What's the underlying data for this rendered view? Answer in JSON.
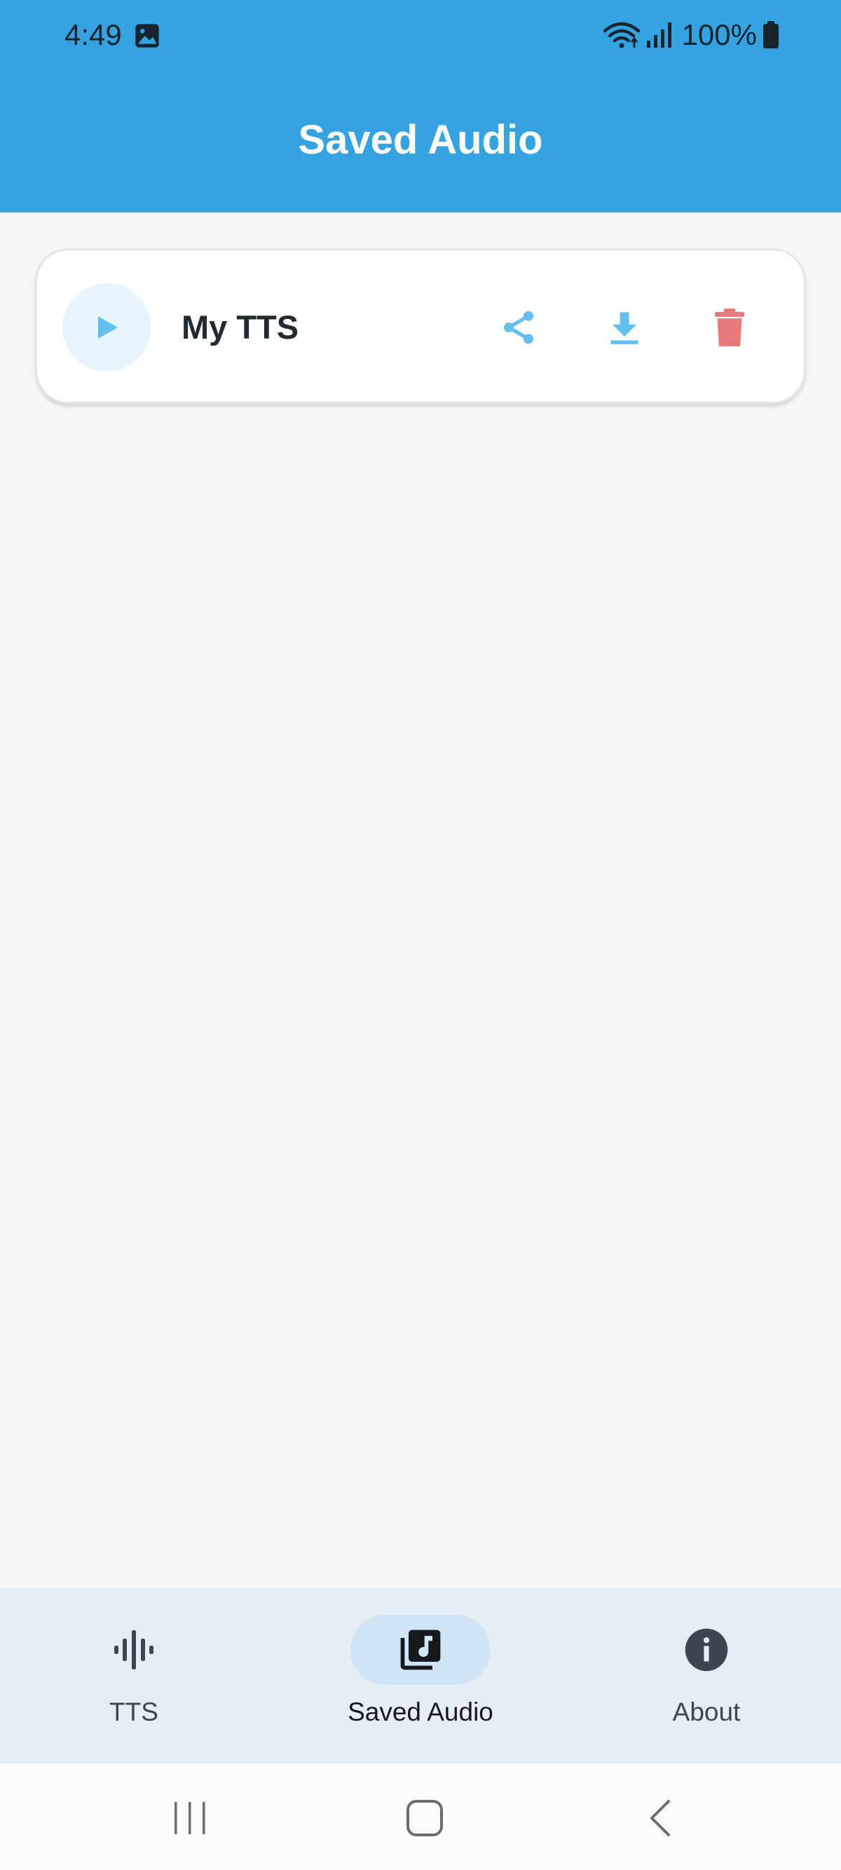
{
  "status_bar": {
    "time": "4:49",
    "battery": "100%"
  },
  "header": {
    "title": "Saved Audio",
    "color": "#34A3E0"
  },
  "audio_items": [
    {
      "name": "My TTS"
    }
  ],
  "icons": {
    "play": "play-icon",
    "share": "share-icon",
    "download": "download-icon",
    "delete": "trash-icon"
  },
  "colors": {
    "accent": "#34A3E0",
    "icon_blue": "#63BFEF",
    "delete_red": "#E8797B",
    "background": "#F5F7F7"
  },
  "bottom_nav": {
    "items": [
      {
        "label": "TTS",
        "icon": "waveform-icon",
        "active": false
      },
      {
        "label": "Saved Audio",
        "icon": "music-library-icon",
        "active": true
      },
      {
        "label": "About",
        "icon": "info-icon",
        "active": false
      }
    ]
  }
}
